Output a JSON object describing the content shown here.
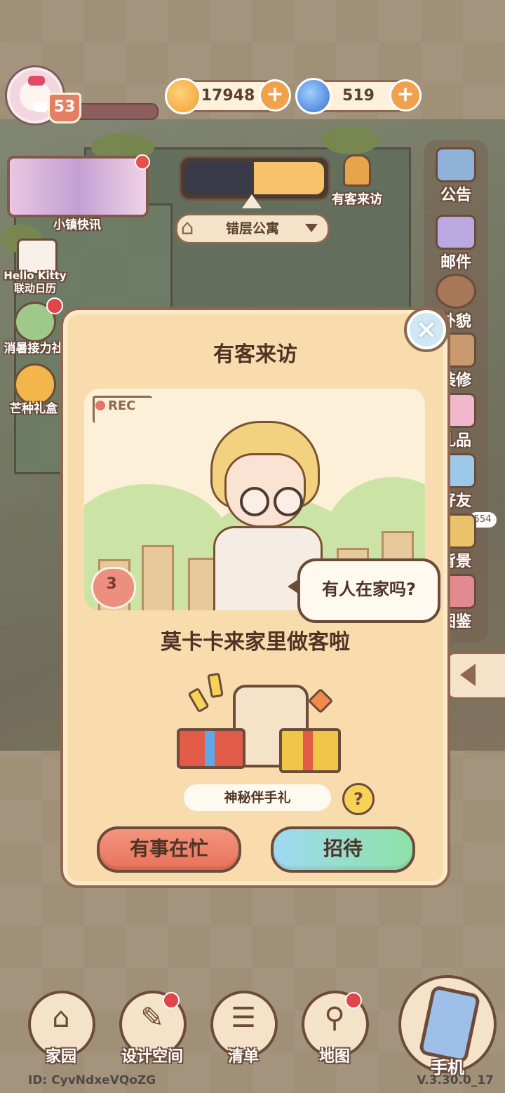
{
  "hud": {
    "level": "53",
    "coins": "17948",
    "gems": "519"
  },
  "left_menu": {
    "news": "小镇快讯",
    "calendar": "Hello Kitty\n联动日历",
    "relay": "消暑接力社",
    "gift_box": "芒种礼盒"
  },
  "top_center": {
    "location": "错层公寓",
    "visitor_alert": "有客来访"
  },
  "right_menu": [
    {
      "label": "公告",
      "icon": "announcement-icon"
    },
    {
      "label": "邮件",
      "icon": "mail-icon"
    },
    {
      "label": "外貌",
      "icon": "appearance-icon"
    },
    {
      "label": "装修",
      "icon": "decorate-icon"
    },
    {
      "label": "礼品",
      "icon": "gift-icon"
    },
    {
      "label": "好友",
      "icon": "friends-icon"
    },
    {
      "label": "背景",
      "icon": "background-icon"
    },
    {
      "label": "图鉴",
      "icon": "collection-icon"
    }
  ],
  "friends_badge": "554",
  "modal": {
    "title": "有客来访",
    "rec_label": "REC",
    "affection": "3",
    "speech": "有人在家吗?",
    "message": "莫卡卡来家里做客啦",
    "gift_label": "神秘伴手礼",
    "help": "?",
    "busy_button": "有事在忙",
    "host_button": "招待"
  },
  "bottom_nav": [
    {
      "label": "家园",
      "icon": "home-icon"
    },
    {
      "label": "设计空间",
      "icon": "design-icon"
    },
    {
      "label": "清单",
      "icon": "list-icon"
    },
    {
      "label": "地图",
      "icon": "map-icon"
    }
  ],
  "phone": "手机",
  "footer": {
    "id": "ID: CyvNdxeVQoZG",
    "version": "V.3.30.0_17"
  },
  "colors": {
    "accent": "#f8dcae",
    "border": "#8e6850",
    "busy": "#e9715c",
    "host": "#8ee2a7"
  }
}
